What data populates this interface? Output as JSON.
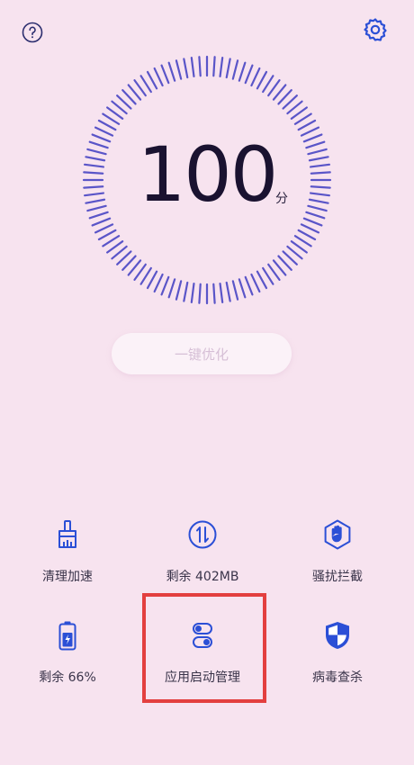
{
  "top": {
    "help_icon": "question-circle-icon",
    "settings_icon": "gear-icon"
  },
  "score": {
    "value": "100",
    "unit": "分",
    "ring_color": "#5a55c8",
    "level": 1.0
  },
  "optimize_button": {
    "label": "一键优化"
  },
  "tools": [
    {
      "label": "清理加速",
      "icon": "broom-icon"
    },
    {
      "label": "剩余 402MB",
      "icon": "memory-arrows-icon"
    },
    {
      "label": "骚扰拦截",
      "icon": "hand-block-icon"
    },
    {
      "label": "剩余 66%",
      "icon": "battery-icon"
    },
    {
      "label": "应用启动管理",
      "icon": "toggle-switches-icon"
    },
    {
      "label": "病毒查杀",
      "icon": "shield-icon"
    }
  ],
  "accent_color": "#2b4fd6",
  "highlight_color": "#e33f3f"
}
